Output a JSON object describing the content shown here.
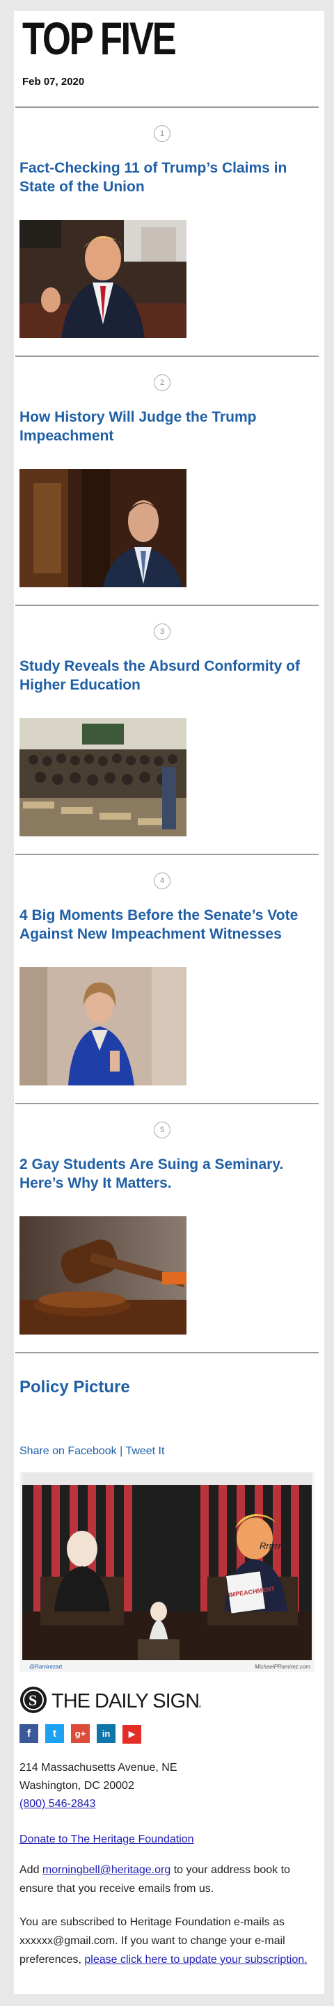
{
  "masthead": "TOP FIVE",
  "date": "Feb 07, 2020",
  "stories": [
    {
      "number": "1",
      "headline": "Fact-Checking 11 of Trump’s Claims in State of the Union"
    },
    {
      "number": "2",
      "headline": "How History Will Judge the Trump Impeachment"
    },
    {
      "number": "3",
      "headline": "Study Reveals the Absurd Conformity of Higher Education"
    },
    {
      "number": "4",
      "headline": "4 Big Moments Before the Senate’s Vote Against New Impeachment Witnesses"
    },
    {
      "number": "5",
      "headline": "2 Gay Students Are Suing a Seminary. Here’s Why It Matters."
    }
  ],
  "policy_picture": {
    "title": "Policy Picture",
    "share_facebook": "Share on Facebook",
    "separator": "|",
    "tweet": "Tweet It",
    "cartoon_text": {
      "paper": "IMPEACHMENT",
      "rip": "Rrrrrrrip",
      "credit_left": "@Ramirezart",
      "credit_right": "MichaelPRamirez.com"
    }
  },
  "footer": {
    "logo_text": "THE DAILY SIGNAL",
    "social": [
      {
        "name": "facebook-icon",
        "glyph": "f",
        "color": "#3b5998"
      },
      {
        "name": "twitter-icon",
        "glyph": "t",
        "color": "#1da1f2"
      },
      {
        "name": "google-plus-icon",
        "glyph": "g+",
        "color": "#dd4b39"
      },
      {
        "name": "linkedin-icon",
        "glyph": "in",
        "color": "#0e76a8"
      },
      {
        "name": "youtube-icon",
        "glyph": "▶",
        "color": "#e52d27"
      }
    ],
    "address_line1": "214 Massachusetts Avenue, NE",
    "address_line2": "Washington, DC 20002",
    "phone": "(800) 546-2843",
    "donate": "Donate to The Heritage Foundation",
    "add_prefix": "Add ",
    "email": "morningbell@heritage.org",
    "add_suffix": " to your address book to ensure that you receive emails from us.",
    "subscribed_text": "You are subscribed to Heritage Foundation e-mails as xxxxxx@gmail.com. If you want to change your e-mail preferences, ",
    "update_link": "please click here to update your subscription."
  }
}
